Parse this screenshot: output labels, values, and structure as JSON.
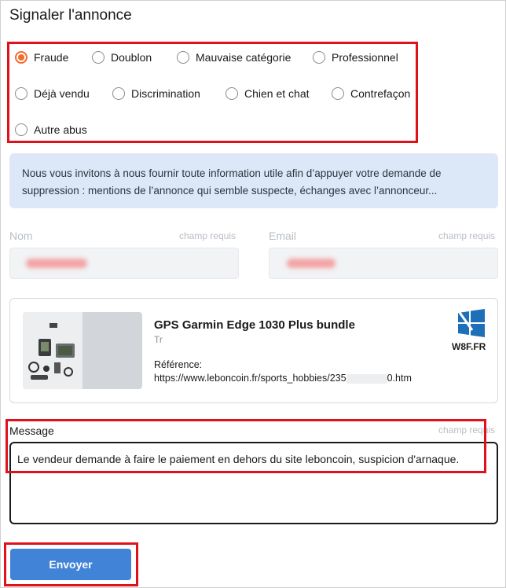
{
  "title": "Signaler l'annonce",
  "reasons": [
    {
      "label": "Fraude",
      "selected": true
    },
    {
      "label": "Doublon",
      "selected": false
    },
    {
      "label": "Mauvaise catégorie",
      "selected": false
    },
    {
      "label": "Professionnel",
      "selected": false
    },
    {
      "label": "Déjà vendu",
      "selected": false
    },
    {
      "label": "Discrimination",
      "selected": false
    },
    {
      "label": "Chien et chat",
      "selected": false
    },
    {
      "label": "Contrefaçon",
      "selected": false
    },
    {
      "label": "Autre abus",
      "selected": false
    }
  ],
  "info_text": "Nous vous invitons à nous fournir toute information utile afin d’appuyer votre demande de suppression : mentions de l’annonce qui semble suspecte, échanges avec l’annonceur...",
  "name_field": {
    "label": "Nom",
    "required": "champ requis"
  },
  "email_field": {
    "label": "Email",
    "required": "champ requis"
  },
  "listing": {
    "title": "GPS Garmin Edge 1030 Plus bundle",
    "subtitle": "Tr",
    "reference_label": "Référence:",
    "reference_url_start": "https://www.leboncoin.fr/sports_hobbies/235",
    "reference_url_end": "0.htm"
  },
  "watermark": {
    "brand": "W8F.FR",
    "icon": "windows-logo-icon"
  },
  "message": {
    "label": "Message",
    "required": "champ requis",
    "value": "Le vendeur demande à faire le paiement en dehors du site leboncoin, suspicion d'arnaque."
  },
  "submit_label": "Envoyer",
  "colors": {
    "accent_orange": "#f56b2a",
    "button_blue": "#4183d7",
    "info_bg": "#dce8f7",
    "highlight_red": "#e0111a"
  }
}
